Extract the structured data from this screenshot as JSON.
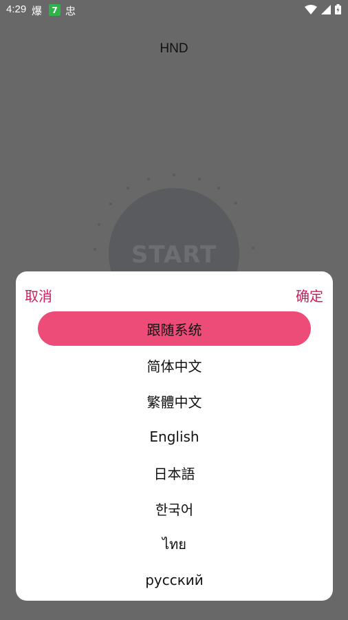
{
  "status_bar": {
    "time": "4:29",
    "notif1": "爆",
    "notif2": "7",
    "notif3": "忠"
  },
  "header": {
    "title": "HND"
  },
  "start_button": {
    "label": "START"
  },
  "dialog": {
    "cancel_label": "取消",
    "confirm_label": "确定",
    "options": [
      "跟随系统",
      "简体中文",
      "繁體中文",
      "English",
      "日本語",
      "한국어",
      "ไทย",
      "русский"
    ],
    "selected_index": 0
  },
  "colors": {
    "accent": "#d3195d",
    "selected_bg": "#ed4b78",
    "overlay_bg": "#686868"
  }
}
